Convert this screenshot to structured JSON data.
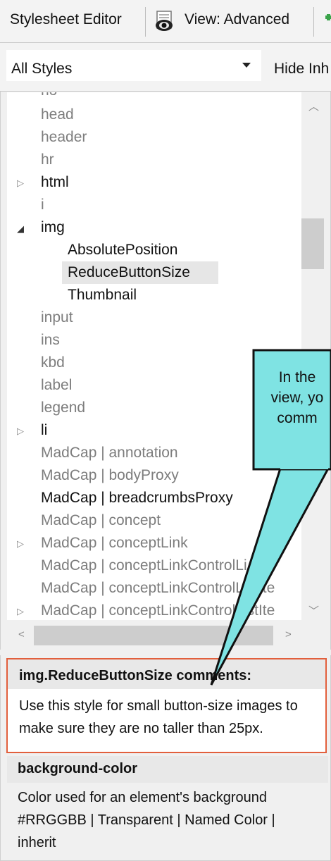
{
  "toolbar": {
    "editor_label": "Stylesheet Editor",
    "view_label": "View: Advanced"
  },
  "filter": {
    "selected": "All Styles",
    "hide_label": "Hide Inh"
  },
  "tree": {
    "items": [
      {
        "label": "no"
      },
      {
        "label": "head"
      },
      {
        "label": "header"
      },
      {
        "label": "hr"
      },
      {
        "label": "html"
      },
      {
        "label": "i"
      },
      {
        "label": "img"
      },
      {
        "label": "AbsolutePosition"
      },
      {
        "label": "ReduceButtonSize"
      },
      {
        "label": "Thumbnail"
      },
      {
        "label": "input"
      },
      {
        "label": "ins"
      },
      {
        "label": "kbd"
      },
      {
        "label": "label"
      },
      {
        "label": "legend"
      },
      {
        "label": "li"
      },
      {
        "label": "MadCap | annotation"
      },
      {
        "label": "MadCap | bodyProxy"
      },
      {
        "label": "MadCap | breadcrumbsProxy"
      },
      {
        "label": "MadCap | concept"
      },
      {
        "label": "MadCap | conceptLink"
      },
      {
        "label": "MadCap | conceptLinkControlLi"
      },
      {
        "label": "MadCap | conceptLinkControlListIte"
      },
      {
        "label": "MadCap | conceptLinkControlListIte"
      }
    ]
  },
  "comments": {
    "title": "img.ReduceButtonSize comments:",
    "body": "Use this style for small button-size images to make sure they are no taller than 25px."
  },
  "property": {
    "title": "background-color",
    "line1": "Color used for an element's background",
    "line2": "#RRGGBB | Transparent | Named Color |",
    "line3": "inherit"
  },
  "callout": {
    "line1": "In the",
    "line2": "view, yo",
    "line3": "comm"
  },
  "colors": {
    "callout_fill": "#7fe3e3",
    "highlight_border": "#e25f3c"
  }
}
